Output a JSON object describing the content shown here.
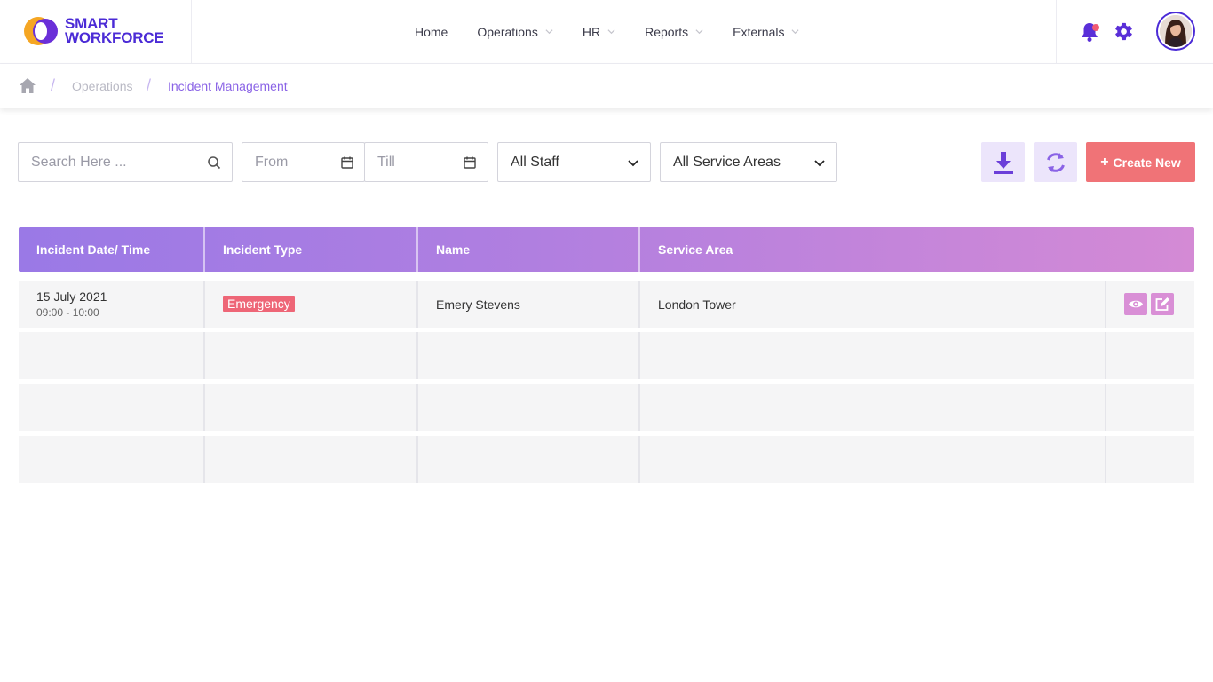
{
  "brand": {
    "line1": "SMART",
    "line2": "WORKFORCE"
  },
  "nav": [
    {
      "label": "Home",
      "has_dropdown": false
    },
    {
      "label": "Operations",
      "has_dropdown": true
    },
    {
      "label": "HR",
      "has_dropdown": true
    },
    {
      "label": "Reports",
      "has_dropdown": true
    },
    {
      "label": "Externals",
      "has_dropdown": true
    }
  ],
  "header_icons": {
    "notifications": "bell-icon",
    "settings": "gear-icon",
    "profile": "avatar"
  },
  "breadcrumb": {
    "home_icon": "home-icon",
    "items": [
      "Operations",
      "Incident Management"
    ],
    "separator": "/"
  },
  "toolbar": {
    "search_placeholder": "Search Here ...",
    "from_placeholder": "From",
    "till_placeholder": "Till",
    "staff_value": "All Staff",
    "service_area_value": "All Service Areas",
    "download_icon": "download-icon",
    "refresh_icon": "refresh-icon",
    "create_label": "Create New"
  },
  "table": {
    "columns": [
      "Incident Date/ Time",
      "Incident Type",
      "Name",
      "Service Area"
    ],
    "rows": [
      {
        "date": "15 July 2021",
        "time": "09:00 - 10:00",
        "type": "Emergency",
        "name": "Emery Stevens",
        "service_area": "London Tower",
        "actions": [
          "view-icon",
          "edit-icon"
        ]
      }
    ]
  },
  "colors": {
    "brand": "#4b2bd6",
    "accent": "#8a63e6",
    "create_button": "#f07377",
    "emergency_badge": "#ee6677",
    "action_button": "#d98fd6",
    "header_gradient_start": "#9a79e6",
    "header_gradient_end": "#d48ad5"
  }
}
